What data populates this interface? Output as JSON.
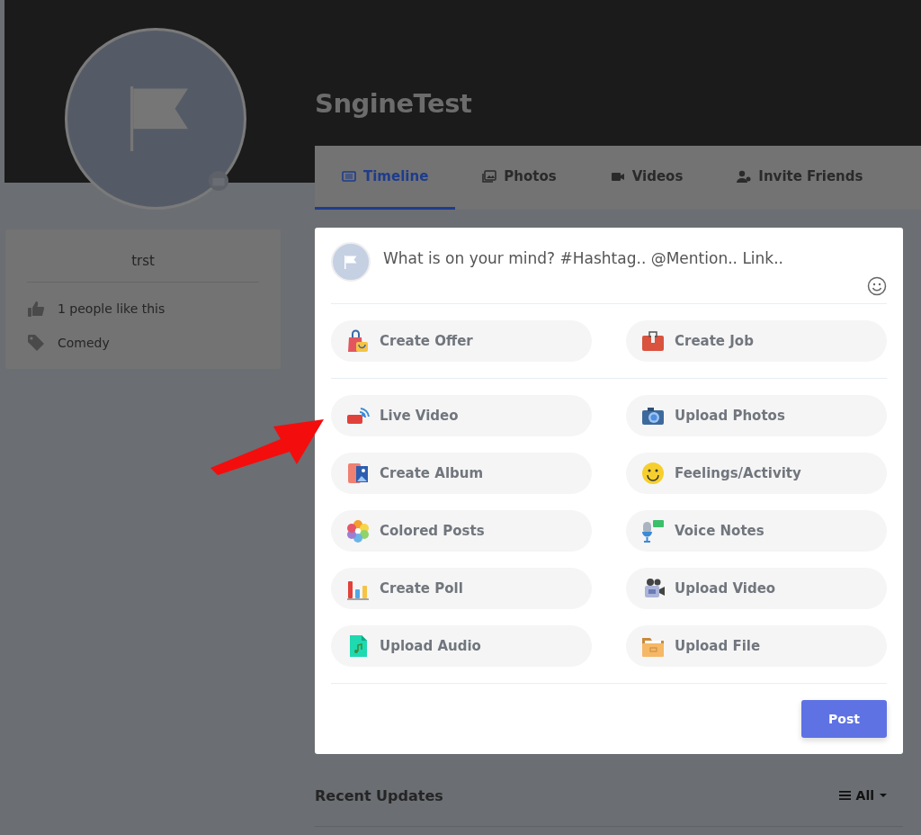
{
  "page": {
    "title": "SngineTest"
  },
  "tabs": [
    {
      "label": "Timeline",
      "kind": "timeline",
      "selected": true
    },
    {
      "label": "Photos",
      "kind": "photos",
      "selected": false
    },
    {
      "label": "Videos",
      "kind": "videos",
      "selected": false
    },
    {
      "label": "Invite Friends",
      "kind": "invite",
      "selected": false
    }
  ],
  "about": {
    "name": "trst",
    "items": [
      {
        "kind": "likes",
        "text": "1 people like this"
      },
      {
        "kind": "category",
        "text": "Comedy"
      }
    ]
  },
  "composer": {
    "placeholder": "What is on your mind? #Hashtag.. @Mention.. Link..",
    "top_actions": [
      {
        "kind": "offer",
        "label": "Create Offer"
      },
      {
        "kind": "job",
        "label": "Create Job"
      }
    ],
    "actions": [
      {
        "kind": "live",
        "label": "Live Video"
      },
      {
        "kind": "photo",
        "label": "Upload Photos"
      },
      {
        "kind": "album",
        "label": "Create Album"
      },
      {
        "kind": "feeling",
        "label": "Feelings/Activity"
      },
      {
        "kind": "colored",
        "label": "Colored Posts"
      },
      {
        "kind": "voice",
        "label": "Voice Notes"
      },
      {
        "kind": "poll",
        "label": "Create Poll"
      },
      {
        "kind": "video",
        "label": "Upload Video"
      },
      {
        "kind": "audio",
        "label": "Upload Audio"
      },
      {
        "kind": "file",
        "label": "Upload File"
      }
    ],
    "post_button": "Post"
  },
  "recent": {
    "title": "Recent Updates",
    "filter": "All"
  }
}
